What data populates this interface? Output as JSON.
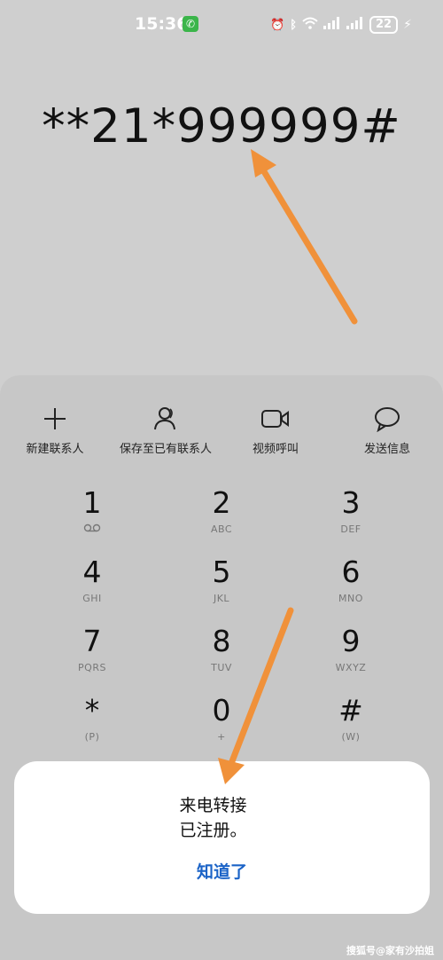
{
  "status_bar": {
    "time": "15:36",
    "battery": "22",
    "icons": [
      "alarm-icon",
      "bluetooth-icon",
      "wifi-icon",
      "signal-1-icon",
      "signal-2-icon"
    ]
  },
  "dialed_number": "**21*999999#",
  "actions": [
    {
      "label": "新建联系人",
      "icon": "plus-icon"
    },
    {
      "label": "保存至已有联系人",
      "icon": "person-icon"
    },
    {
      "label": "视频呼叫",
      "icon": "video-icon"
    },
    {
      "label": "发送信息",
      "icon": "message-icon"
    }
  ],
  "keypad": [
    {
      "num": "1",
      "sub": "voicemail"
    },
    {
      "num": "2",
      "sub": "ABC"
    },
    {
      "num": "3",
      "sub": "DEF"
    },
    {
      "num": "4",
      "sub": "GHI"
    },
    {
      "num": "5",
      "sub": "JKL"
    },
    {
      "num": "6",
      "sub": "MNO"
    },
    {
      "num": "7",
      "sub": "PQRS"
    },
    {
      "num": "8",
      "sub": "TUV"
    },
    {
      "num": "9",
      "sub": "WXYZ"
    },
    {
      "num": "*",
      "sub": "(P)"
    },
    {
      "num": "0",
      "sub": "+"
    },
    {
      "num": "#",
      "sub": "(W)"
    }
  ],
  "dialog": {
    "message_line1": "来电转接",
    "message_line2": "已注册。",
    "button": "知道了"
  },
  "watermark": "搜狐号@家有沙拍姐",
  "colors": {
    "arrow": "#f0913a",
    "dialog_button": "#1b63c7",
    "background": "#cfcfcf"
  }
}
